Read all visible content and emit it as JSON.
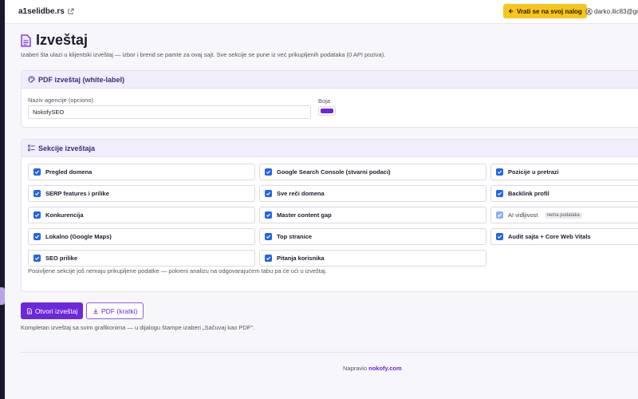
{
  "topbar": {
    "site_name": "a1selidbe.rs",
    "back_button_label": "Vrati se na svoj nalog",
    "user_email": "darko.ilic83@gm"
  },
  "page": {
    "title": "Izveštaj",
    "subtitle": "Izaberi šta ulazi u klijentski izveštaj — izbor i brend se pamte za ovaj sajt. Sve sekcije se pune iz već prikupljenih podataka (0 API poziva)."
  },
  "pdf_card": {
    "title": "PDF izveštaj (white-label)",
    "agency_label": "Naziv agencije (opciono)",
    "agency_value": "NokofySEO",
    "color_label": "Boja",
    "color_value": "#6d28d9"
  },
  "sections_card": {
    "title": "Sekcije izveštaja",
    "items": [
      {
        "label": "Pregled domena",
        "checked": true,
        "disabled": false
      },
      {
        "label": "Google Search Console (stvarni podaci)",
        "checked": true,
        "disabled": false
      },
      {
        "label": "Pozicije u pretrazi",
        "checked": true,
        "disabled": false
      },
      {
        "label": "SERP features i prilike",
        "checked": true,
        "disabled": false
      },
      {
        "label": "Sve reči domena",
        "checked": true,
        "disabled": false
      },
      {
        "label": "Backlink profil",
        "checked": true,
        "disabled": false
      },
      {
        "label": "Konkurencija",
        "checked": true,
        "disabled": false
      },
      {
        "label": "Master content gap",
        "checked": true,
        "disabled": false
      },
      {
        "label": "AI vidljivost",
        "checked": true,
        "disabled": true,
        "badge": "nema podataka"
      },
      {
        "label": "Lokalno (Google Maps)",
        "checked": true,
        "disabled": false
      },
      {
        "label": "Top stranice",
        "checked": true,
        "disabled": false
      },
      {
        "label": "Audit sajta + Core Web Vitals",
        "checked": true,
        "disabled": false
      },
      {
        "label": "SEO prilike",
        "checked": true,
        "disabled": false
      },
      {
        "label": "Pitanja korisnika",
        "checked": true,
        "disabled": false
      }
    ],
    "note": "Posivljene sekcije još nemaju prikupljene podatke — pokreni analizu na odgovarajućem tabu pa će ući u izveštaj."
  },
  "actions": {
    "open_report_label": "Otvori izveštaj",
    "pdf_short_label": "PDF (kratki)",
    "hint": "Kompletan izveštaj sa svim grafikonima — u dijalogu štampe izaberi „Sačuvaj kao PDF\"."
  },
  "footer": {
    "prefix": "Napravio",
    "brand": "nokofy.com"
  },
  "colors": {
    "accent": "#6d28d9",
    "checkbox": "#2563eb",
    "warning_button": "#f7c51d",
    "sidebar": "#1b1530"
  }
}
